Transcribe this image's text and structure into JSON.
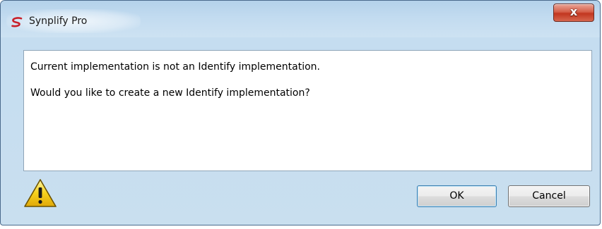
{
  "window": {
    "title": "Synplify Pro",
    "close_label": "x"
  },
  "icons": {
    "app": "synplify-logo-icon",
    "warning": "warning-icon"
  },
  "message": {
    "line1": "Current implementation is not an Identify implementation.",
    "line2": "Would you like to create a new Identify implementation?"
  },
  "buttons": {
    "ok_label": "OK",
    "cancel_label": "Cancel"
  },
  "colors": {
    "logo_red": "#c8202a",
    "warning_yellow": "#f7d21c",
    "close_red": "#c2361f"
  }
}
